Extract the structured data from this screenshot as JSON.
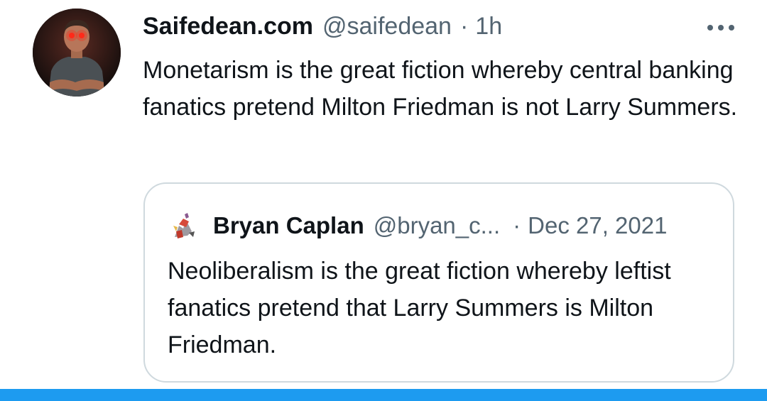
{
  "tweet": {
    "author_name": "Saifedean.com",
    "author_handle": "@saifedean",
    "separator": "·",
    "time": "1h",
    "text": "Monetarism is the great fiction whereby central banking fanatics pretend Milton Friedman is not Larry Summers.",
    "more_icon": "more-horizontal-icon"
  },
  "quote": {
    "author_name": "Bryan Caplan",
    "author_handle": "@bryan_c...",
    "separator": "·",
    "date": "Dec 27, 2021",
    "text": "Neoliberalism is the great fiction whereby leftist fanatics pretend that Larry Summers is Milton Friedman."
  },
  "colors": {
    "text_primary": "#0f1419",
    "text_secondary": "#536471",
    "quote_border": "#cfd9de",
    "accent_bar": "#1d9bf0"
  }
}
